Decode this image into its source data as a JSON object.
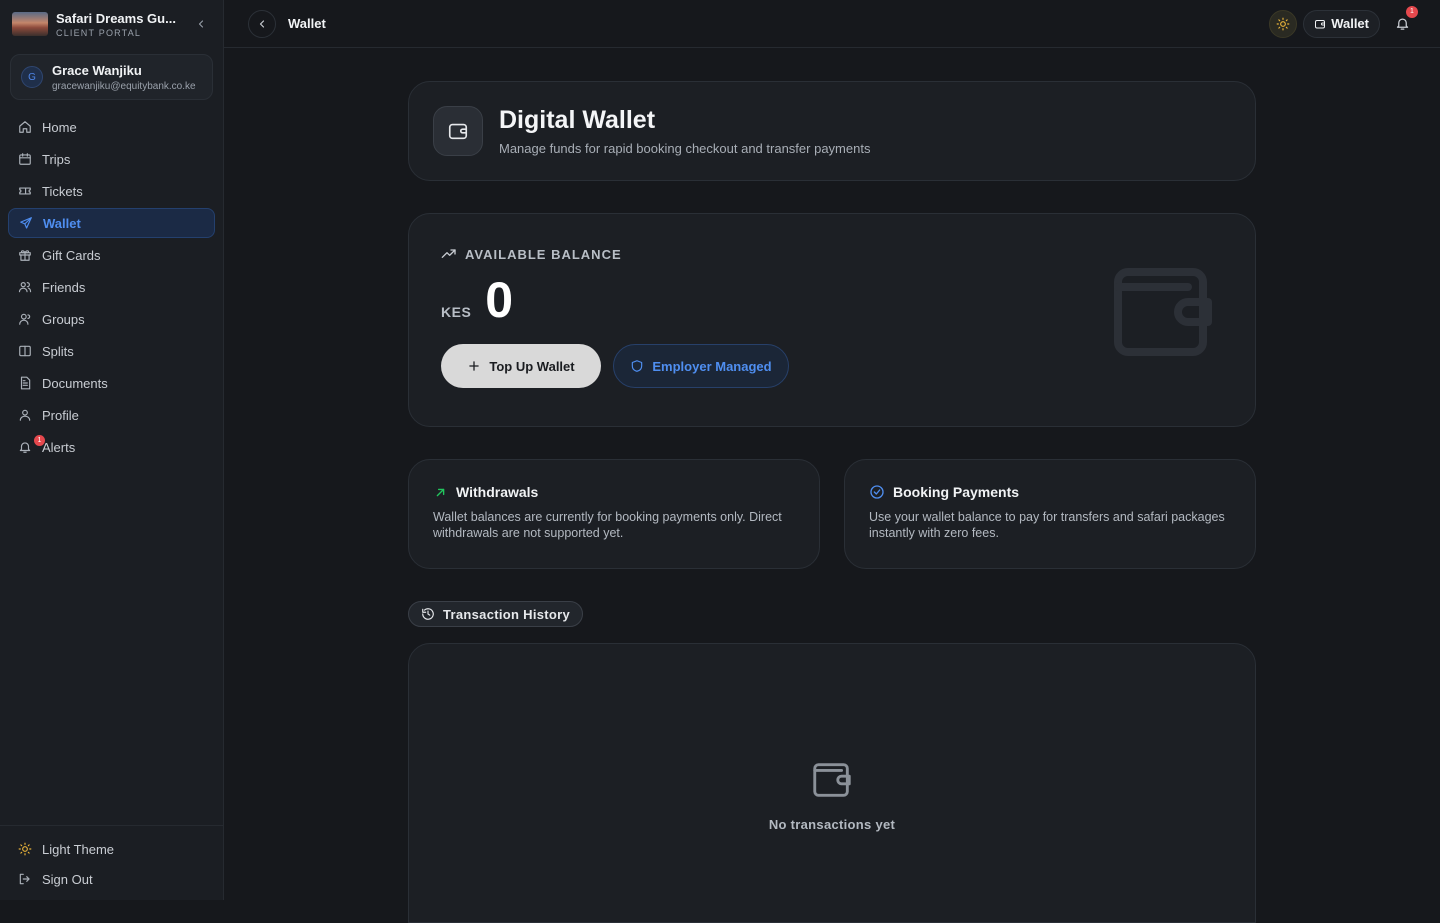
{
  "brand": {
    "name": "Safari Dreams Gu...",
    "subtitle": "CLIENT PORTAL"
  },
  "user": {
    "initial": "G",
    "name": "Grace Wanjiku",
    "email": "gracewanjiku@equitybank.co.ke"
  },
  "sidebar": {
    "items": [
      {
        "label": "Home",
        "icon": "home-icon"
      },
      {
        "label": "Trips",
        "icon": "calendar-icon"
      },
      {
        "label": "Tickets",
        "icon": "ticket-icon"
      },
      {
        "label": "Wallet",
        "icon": "send-icon",
        "active": true
      },
      {
        "label": "Gift Cards",
        "icon": "gift-icon"
      },
      {
        "label": "Friends",
        "icon": "users-icon"
      },
      {
        "label": "Groups",
        "icon": "group-icon"
      },
      {
        "label": "Splits",
        "icon": "split-icon"
      },
      {
        "label": "Documents",
        "icon": "document-icon"
      },
      {
        "label": "Profile",
        "icon": "user-icon"
      },
      {
        "label": "Alerts",
        "icon": "bell-icon",
        "badge": "1"
      }
    ],
    "footer": {
      "theme_label": "Light Theme",
      "signout_label": "Sign Out"
    }
  },
  "topbar": {
    "title": "Wallet",
    "wallet_label": "Wallet",
    "notification_count": "1"
  },
  "header": {
    "title": "Digital Wallet",
    "subtitle": "Manage funds for rapid booking checkout and transfer payments"
  },
  "balance": {
    "label": "AVAILABLE BALANCE",
    "currency": "KES",
    "amount": "0",
    "topup_label": "Top Up Wallet",
    "employer_label": "Employer Managed"
  },
  "info_cards": [
    {
      "title": "Withdrawals",
      "text": "Wallet balances are currently for booking payments only. Direct withdrawals are not supported yet.",
      "icon": "arrow-up-right-icon"
    },
    {
      "title": "Booking Payments",
      "text": "Use your wallet balance to pay for transfers and safari packages instantly with zero fees.",
      "icon": "check-circle-icon"
    }
  ],
  "history": {
    "label": "Transaction History",
    "empty_text": "No transactions yet"
  },
  "colors": {
    "accent": "#4f8ef0",
    "background": "#16181c",
    "card": "#1c1f24",
    "success": "#22c55e",
    "badge": "#e5484d",
    "theme_icon": "#e8b33a"
  }
}
